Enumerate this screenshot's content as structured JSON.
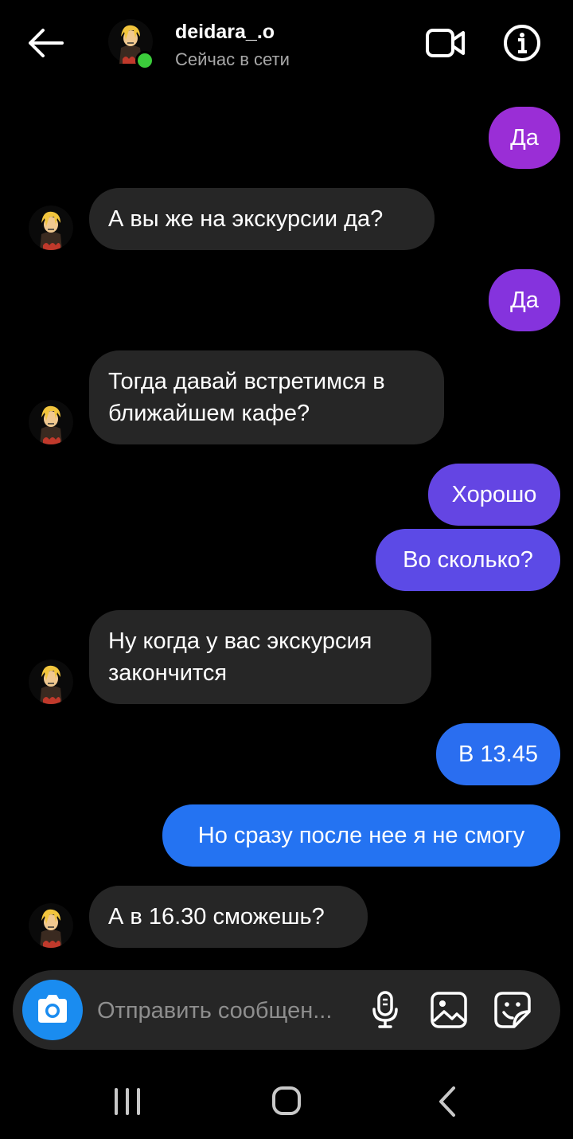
{
  "header": {
    "username": "deidara_.o",
    "status": "Сейчас в сети"
  },
  "messages": [
    {
      "side": "out",
      "text": "Да",
      "color": "#9a2ed6"
    },
    {
      "side": "in",
      "text": "А вы же на экскурсии да?"
    },
    {
      "side": "out",
      "text": "Да",
      "color": "#8533dd"
    },
    {
      "side": "in",
      "text": "Тогда давай встретимся в ближайшем кафе?"
    },
    {
      "side": "out",
      "text": "Хорошо",
      "color": "#6445e3"
    },
    {
      "side": "out",
      "text": "Во сколько?",
      "color": "#5c4ae6"
    },
    {
      "side": "in",
      "text": "Ну когда у вас экскурсия закончится"
    },
    {
      "side": "out",
      "text": "В 13.45",
      "color": "#2a6ef0"
    },
    {
      "side": "out",
      "text": "Но сразу после нее я не смогу",
      "color": "#2473f2"
    },
    {
      "side": "in",
      "text": "А в 16.30 сможешь?"
    }
  ],
  "composer": {
    "placeholder": "Отправить сообщен..."
  },
  "icons": {
    "back": "arrow-left-icon",
    "video": "video-call-icon",
    "info": "info-icon",
    "camera": "camera-icon",
    "mic": "microphone-icon",
    "gallery": "image-icon",
    "sticker": "sticker-icon",
    "nav_recent": "recent-apps-icon",
    "nav_home": "home-icon",
    "nav_back": "nav-back-icon"
  },
  "colors": {
    "background": "#000000",
    "incoming_bubble": "#262626",
    "online": "#3bcc3b",
    "camera_button": "#1a8cf0"
  }
}
